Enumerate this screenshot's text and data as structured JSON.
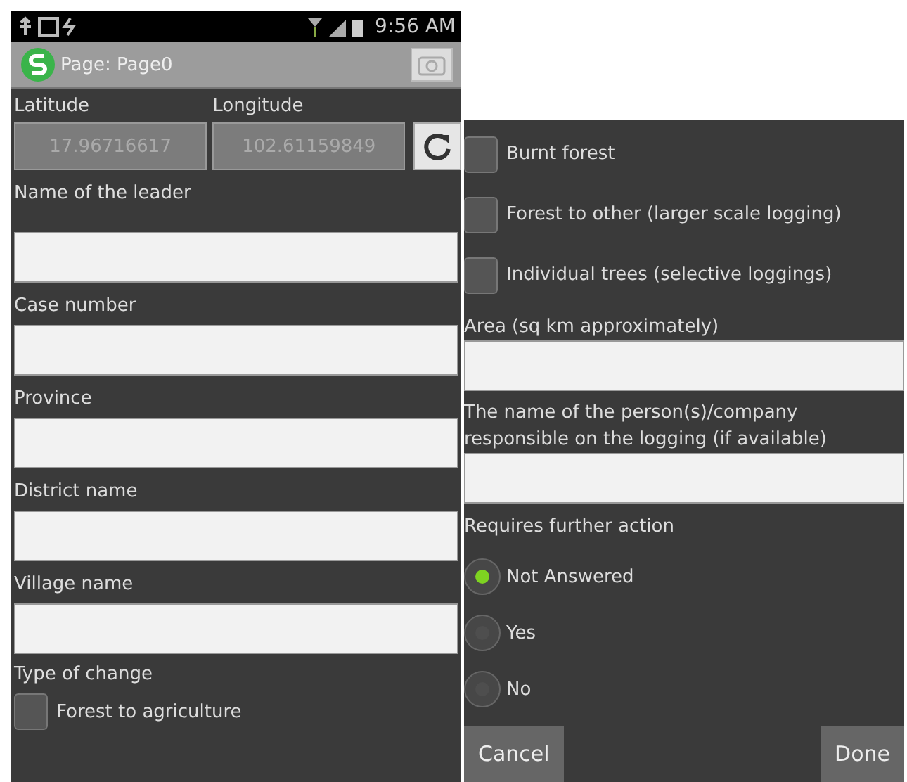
{
  "status_bar": {
    "time": "9:56 AM"
  },
  "app_bar": {
    "title": "Page: Page0"
  },
  "location": {
    "latitude_label": "Latitude",
    "latitude": "17.96716617",
    "longitude_label": "Longitude",
    "longitude": "102.61159849"
  },
  "left_fields": [
    {
      "label": "Name of the leader"
    },
    {
      "label": "Case number"
    },
    {
      "label": "Province"
    },
    {
      "label": "District name"
    },
    {
      "label": "Village name"
    }
  ],
  "type_of_change": {
    "label": "Type of change",
    "options": [
      {
        "label": "Forest to agriculture",
        "checked": false
      }
    ]
  },
  "right_options": [
    {
      "label": "Burnt forest",
      "checked": false
    },
    {
      "label": "Forest to other (larger scale logging)",
      "checked": false
    },
    {
      "label": "Individual trees (selective loggings)",
      "checked": false
    }
  ],
  "right_fields": [
    {
      "label": "Area (sq km approximately)"
    },
    {
      "label": "The name of the person(s)/company responsible on the logging (if available)"
    }
  ],
  "further_action": {
    "label": "Requires further action",
    "options": [
      {
        "label": "Not Answered",
        "selected": true
      },
      {
        "label": "Yes",
        "selected": false
      },
      {
        "label": "No",
        "selected": false
      }
    ]
  },
  "buttons": [
    {
      "label": "Cancel"
    },
    {
      "label": "Done"
    }
  ]
}
